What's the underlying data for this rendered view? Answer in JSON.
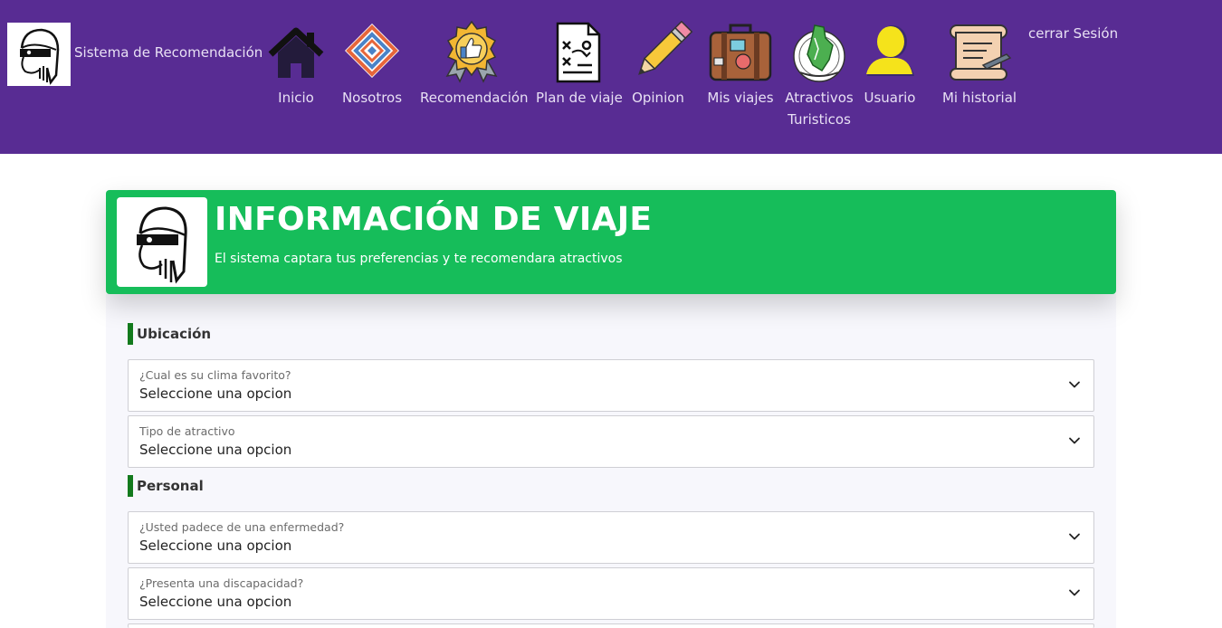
{
  "brand": {
    "title": "Sistema de Recomendación",
    "logo_icon": "masked-man-logo"
  },
  "nav": {
    "items": [
      {
        "label": "Inicio",
        "icon": "house-icon"
      },
      {
        "label": "Nosotros",
        "icon": "diamond-pattern-icon"
      },
      {
        "label": "Recomendación",
        "icon": "thumbs-up-badge-icon"
      },
      {
        "label": "Plan de viaje",
        "icon": "strategy-plan-icon"
      },
      {
        "label": "Opinion",
        "icon": "pencil-icon"
      },
      {
        "label": "Mis viajes",
        "icon": "suitcase-icon"
      },
      {
        "label": "Atractivos",
        "label2": "Turisticos",
        "icon": "amazonas-map-icon"
      },
      {
        "label": "Usuario",
        "icon": "user-silhouette-icon"
      },
      {
        "label": "Mi historial",
        "icon": "scroll-icon"
      }
    ],
    "logout": "cerrar Sesión"
  },
  "hero": {
    "title": "INFORMACIÓN DE VIAJE",
    "subtitle": "El sistema captara tus preferencias y te recomendara atractivos"
  },
  "form": {
    "sections": [
      {
        "title": "Ubicación"
      },
      {
        "title": "Personal"
      }
    ],
    "fields": [
      {
        "label": "¿Cual es su clima favorito?",
        "value": "Seleccione una opcion"
      },
      {
        "label": "Tipo de atractivo",
        "value": "Seleccione una opcion"
      },
      {
        "label": "¿Usted padece de una enfermedad?",
        "value": "Seleccione una opcion"
      },
      {
        "label": "¿Presenta una discapacidad?",
        "value": "Seleccione una opcion"
      }
    ]
  },
  "colors": {
    "navbar": "#582c93",
    "hero": "#16bd5a",
    "section_accent": "#137a1d"
  }
}
